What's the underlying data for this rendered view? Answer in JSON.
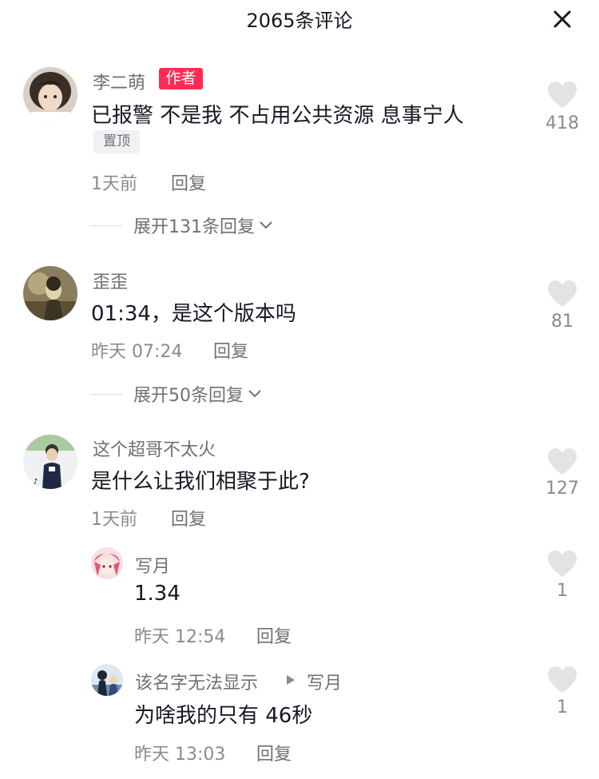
{
  "header": {
    "title": "2065条评论",
    "close_icon": "close-icon"
  },
  "colors": {
    "accent": "#fe2c55",
    "text": "#161823",
    "muted": "#8a8b91",
    "like": "#e3e3e6"
  },
  "comments": [
    {
      "author": "李二萌",
      "author_badge": "作者",
      "text": "已报警 不是我 不占用公共资源 息事宁人",
      "pin_label": "置顶",
      "time": "1天前",
      "reply_label": "回复",
      "likes": "418",
      "expand_label": "展开131条回复"
    },
    {
      "author": "歪歪",
      "text": "01:34，是这个版本吗",
      "time": "昨天 07:24",
      "reply_label": "回复",
      "likes": "81",
      "expand_label": "展开50条回复"
    },
    {
      "author": "这个超哥不太火",
      "text": "是什么让我们相聚于此?",
      "time": "1天前",
      "reply_label": "回复",
      "likes": "127",
      "replies": [
        {
          "author": "写月",
          "text": "1.34",
          "time": "昨天 12:54",
          "reply_label": "回复",
          "likes": "1"
        },
        {
          "author": "该名字无法显示",
          "reply_to": "写月",
          "text": "为啥我的只有 46秒",
          "time": "昨天 13:03",
          "reply_label": "回复",
          "likes": "1"
        }
      ]
    }
  ]
}
